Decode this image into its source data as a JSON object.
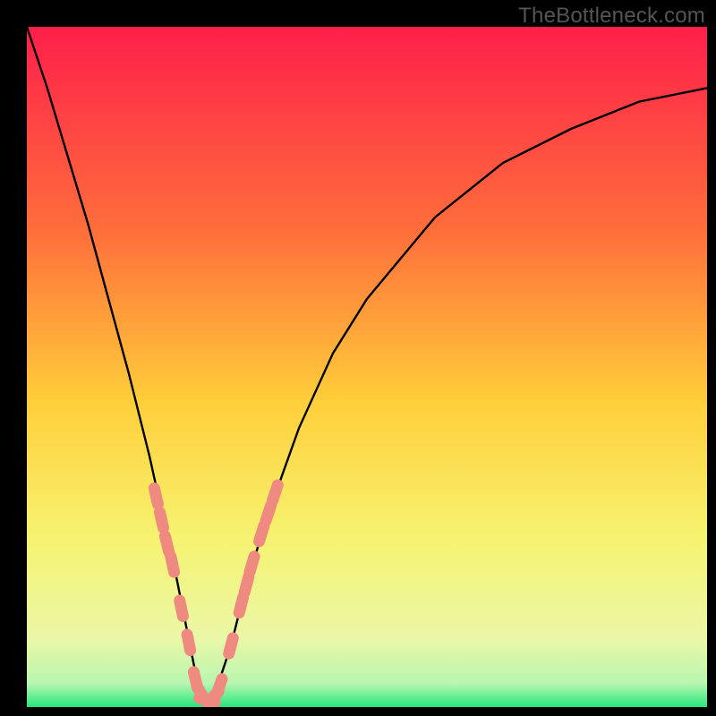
{
  "watermark": "TheBottleneck.com",
  "colors": {
    "frame": "#000000",
    "grad_top": "#ff1f4b",
    "grad_mid1": "#ff6e3b",
    "grad_mid2": "#ffce3a",
    "grad_mid3": "#f6f370",
    "grad_mid4": "#eaf7a7",
    "grad_bottom": "#26e87a",
    "curve": "#000000",
    "pill": "#ef8a80"
  },
  "chart_data": {
    "type": "line",
    "title": "",
    "xlabel": "",
    "ylabel": "",
    "xlim": [
      0,
      100
    ],
    "ylim": [
      0,
      100
    ],
    "note": "Axes are unlabeled in the image; values below are estimated by reading relative positions in the 760x760 plot area. y=0 is the bottom (green band) and y=100 is the top (red). The curve resembles a bottleneck plot: high on both sides, dipping to ~0 near x≈26.",
    "series": [
      {
        "name": "bottleneck-curve",
        "x": [
          0,
          3,
          6,
          9,
          12,
          15,
          18,
          20,
          22,
          24,
          25,
          26,
          27,
          28,
          30,
          32,
          35,
          40,
          45,
          50,
          60,
          70,
          80,
          90,
          100
        ],
        "y": [
          100,
          91,
          81,
          71,
          60,
          49,
          37,
          28,
          19,
          9,
          4,
          1,
          1,
          3,
          9,
          17,
          27,
          41,
          52,
          60,
          72,
          80,
          85,
          89,
          91
        ]
      }
    ],
    "markers": [
      {
        "name": "left-cluster-1",
        "x": 19.0,
        "y": 31.0
      },
      {
        "name": "left-cluster-2",
        "x": 19.8,
        "y": 27.5
      },
      {
        "name": "left-cluster-3",
        "x": 20.6,
        "y": 24.0
      },
      {
        "name": "left-cluster-4",
        "x": 21.4,
        "y": 21.0
      },
      {
        "name": "left-dot-1",
        "x": 22.7,
        "y": 14.5
      },
      {
        "name": "left-dot-2",
        "x": 23.8,
        "y": 9.5
      },
      {
        "name": "valley-1",
        "x": 24.8,
        "y": 4.0
      },
      {
        "name": "valley-2",
        "x": 25.6,
        "y": 2.0
      },
      {
        "name": "valley-3",
        "x": 26.5,
        "y": 1.0
      },
      {
        "name": "valley-4",
        "x": 27.4,
        "y": 1.5
      },
      {
        "name": "valley-5",
        "x": 28.3,
        "y": 3.0
      },
      {
        "name": "right-dot-1",
        "x": 30.0,
        "y": 9.0
      },
      {
        "name": "right-cluster-1",
        "x": 31.5,
        "y": 15.0
      },
      {
        "name": "right-cluster-2",
        "x": 32.3,
        "y": 18.0
      },
      {
        "name": "right-cluster-3",
        "x": 33.1,
        "y": 21.0
      },
      {
        "name": "right-cluster-4",
        "x": 34.5,
        "y": 25.5
      },
      {
        "name": "right-cluster-5",
        "x": 35.5,
        "y": 28.5
      },
      {
        "name": "right-cluster-6",
        "x": 36.5,
        "y": 31.5
      }
    ],
    "gradient_stops": [
      {
        "pos": 0.0,
        "color": "#ff1f4b"
      },
      {
        "pos": 0.3,
        "color": "#ff6e3b"
      },
      {
        "pos": 0.55,
        "color": "#ffce3a"
      },
      {
        "pos": 0.75,
        "color": "#f6f370"
      },
      {
        "pos": 0.9,
        "color": "#eaf7a7"
      },
      {
        "pos": 0.965,
        "color": "#b9f6b0"
      },
      {
        "pos": 1.0,
        "color": "#26e87a"
      }
    ]
  }
}
